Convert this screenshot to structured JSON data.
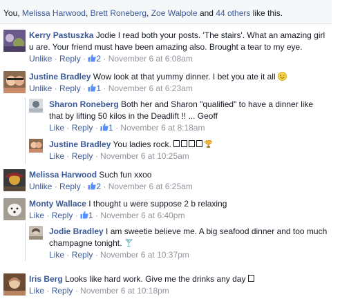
{
  "likes_bar": {
    "prefix": "You, ",
    "names": [
      "Melissa Harwood",
      "Brett Roneberg",
      "Zoe Walpole"
    ],
    "sep1": ", ",
    "sep2": ", ",
    "and": " and ",
    "others": "44 others",
    "suffix": " like this."
  },
  "actions": {
    "unlike": "Unlike",
    "like": "Like",
    "reply": "Reply",
    "dot": " · "
  },
  "comments": [
    {
      "author": "Kerry Pastuszka",
      "text": "Jodie I read both your posts. 'The stairs'. What an amazing girl u are. Your friend must have been amazing also. Brought a tear to my eye.",
      "action": "Unlike",
      "likes": "2",
      "time": "November 6 at 6:08am",
      "avatar": {
        "colors": [
          "#6a5a8a",
          "#8c9a5a",
          "#c9b7d6"
        ]
      }
    },
    {
      "author": "Justine Bradley",
      "text": "Wow look at that yummy dinner. I bet you ate it all",
      "emoji": "wink-emoji",
      "action": "Unlike",
      "likes": "1",
      "time": "November 6 at 6:23am",
      "avatar": {
        "colors": [
          "#c98a6a",
          "#f2c7a5",
          "#8a6b50"
        ]
      }
    },
    {
      "author": "Sharon Roneberg",
      "text": "Both her and Sharon \"qualified\" to have a dinner like that by lifting 50 kilos in the Deadlift !! ... Geoff",
      "action": "Like",
      "likes": "1",
      "time": "November 6 at 8:18am",
      "avatar": {
        "colors": [
          "#b0b6bd",
          "#6d7a86",
          "#d9dde1"
        ]
      }
    },
    {
      "author": "Justine Bradley",
      "text": "You ladies rock.",
      "boxes": 4,
      "emoji": "trophy-emoji",
      "action": "Like",
      "likes": "",
      "time": "November 6 at 10:25am",
      "avatar": {
        "colors": [
          "#c98a6a",
          "#f2c7a5",
          "#8a6b50"
        ]
      }
    },
    {
      "author": "Melissa Harwood",
      "text": "Such fun xxoo",
      "action": "Unlike",
      "likes": "2",
      "time": "November 6 at 6:25am",
      "avatar": {
        "colors": [
          "#8a2a2a",
          "#d9a23a",
          "#3a3a3a"
        ]
      }
    },
    {
      "author": "Monty Wallace",
      "text": "I thought u were suppose 2 b relaxing",
      "action": "Like",
      "likes": "1",
      "time": "November 6 at 6:40pm",
      "avatar": {
        "colors": [
          "#e8e6e1",
          "#c7c2b8",
          "#a39d92"
        ]
      }
    },
    {
      "author": "Jodie Bradley",
      "text": "I am sweetie believe me. A big seafood dinner and too much champagne tonight.",
      "emoji": "cocktail-emoji",
      "action": "Like",
      "likes": "",
      "time": "November 6 at 10:37pm",
      "avatar": {
        "colors": [
          "#c8c0b5",
          "#9a8d7e",
          "#5a4f45"
        ]
      }
    },
    {
      "author": "Iris Berg",
      "text": "Looks like hard work. Give me the drinks any day",
      "boxes_after": 1,
      "action": "Like",
      "likes": "",
      "time": "November 6 at 10:18pm",
      "avatar": {
        "colors": [
          "#e9c8a8",
          "#b78462",
          "#6b4a33"
        ]
      }
    }
  ],
  "colors": {
    "link": "#3b5998",
    "meta": "#90949c",
    "bg_bar": "#f6f7f9"
  }
}
